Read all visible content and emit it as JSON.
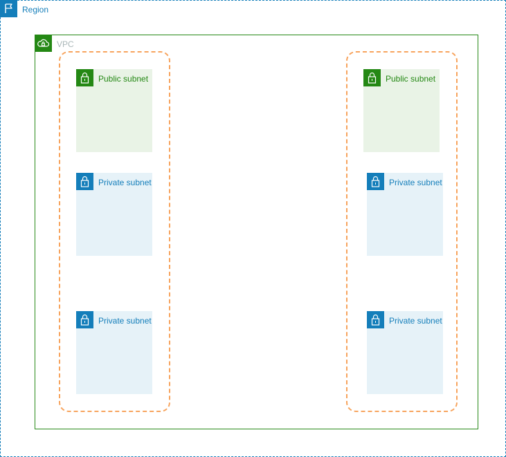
{
  "region": {
    "label": "Region",
    "icon": "flag-icon"
  },
  "vpc": {
    "label": "VPC",
    "icon": "cloud-lock-icon"
  },
  "availability_zones": [
    {
      "subnets": [
        {
          "label": "Public subnet",
          "type": "public"
        },
        {
          "label": "Private subnet",
          "type": "private"
        },
        {
          "label": "Private subnet",
          "type": "private"
        }
      ]
    },
    {
      "subnets": [
        {
          "label": "Public subnet",
          "type": "public"
        },
        {
          "label": "Private subnet",
          "type": "private"
        },
        {
          "label": "Private subnet",
          "type": "private"
        }
      ]
    }
  ],
  "colors": {
    "region": "#147eba",
    "vpc": "#248814",
    "vpc_label": "#aab7b8",
    "public_subnet_fill": "#e9f3e6",
    "private_subnet_fill": "#e6f2f8",
    "availability_zone_border": "#f7a35c"
  }
}
